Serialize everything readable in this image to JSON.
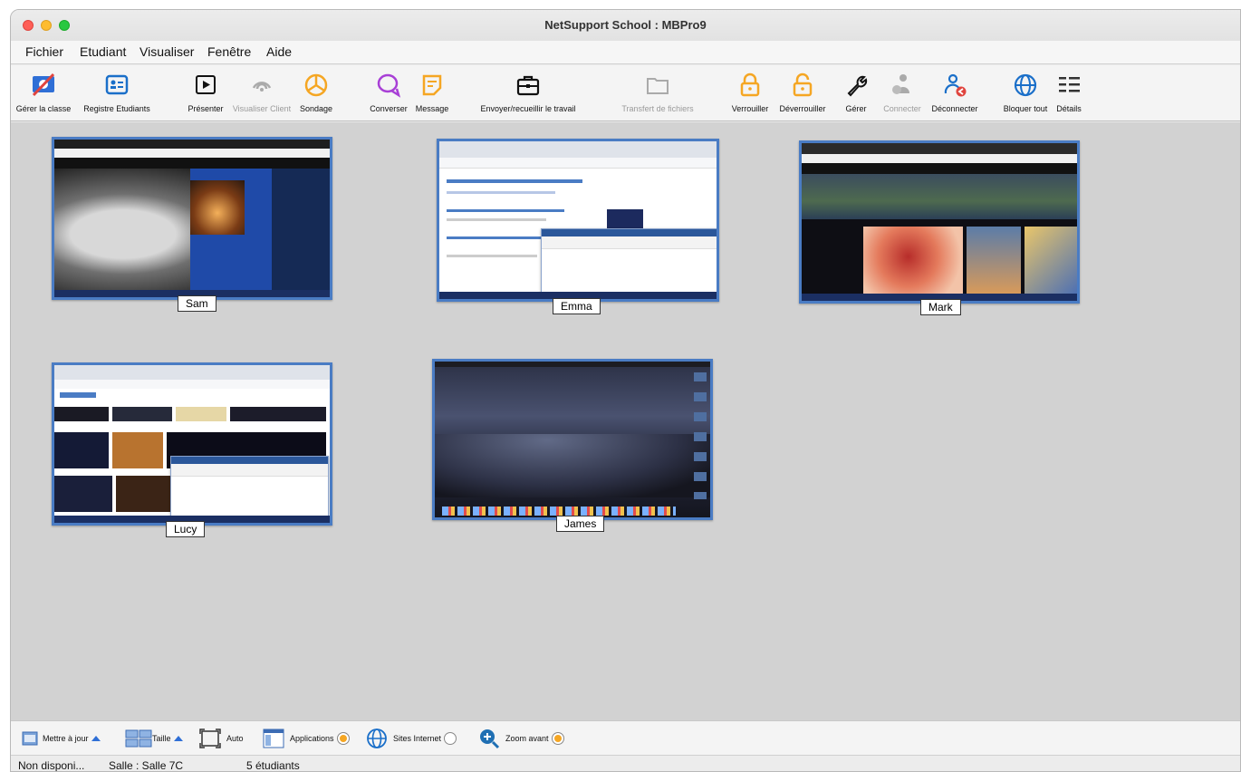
{
  "window": {
    "title": "NetSupport School : MBPro9"
  },
  "menu": [
    "Fichier",
    "Etudiant",
    "Visualiser",
    "Fenêtre",
    "Aide"
  ],
  "toolbar": [
    {
      "label": "Gérer la classe",
      "icon": "manage-class-icon",
      "enabled": true
    },
    {
      "label": "Registre Etudiants",
      "icon": "student-register-icon",
      "enabled": true
    },
    {
      "label": "Présenter",
      "icon": "present-icon",
      "enabled": true
    },
    {
      "label": "Visualiser Client",
      "icon": "view-client-icon",
      "enabled": false
    },
    {
      "label": "Sondage",
      "icon": "survey-icon",
      "enabled": true
    },
    {
      "label": "Converser",
      "icon": "chat-icon",
      "enabled": true
    },
    {
      "label": "Message",
      "icon": "message-icon",
      "enabled": true
    },
    {
      "label": "Envoyer/recueillir le travail",
      "icon": "send-collect-work-icon",
      "enabled": true
    },
    {
      "label": "Transfert de fichiers",
      "icon": "file-transfer-icon",
      "enabled": false
    },
    {
      "label": "Verrouiller",
      "icon": "lock-icon",
      "enabled": true
    },
    {
      "label": "Déverrouiller",
      "icon": "unlock-icon",
      "enabled": true
    },
    {
      "label": "Gérer",
      "icon": "wrench-icon",
      "enabled": true
    },
    {
      "label": "Connecter",
      "icon": "connect-icon",
      "enabled": false
    },
    {
      "label": "Déconnecter",
      "icon": "disconnect-icon",
      "enabled": true
    },
    {
      "label": "Bloquer tout",
      "icon": "globe-icon",
      "enabled": true
    },
    {
      "label": "Détails",
      "icon": "details-list-icon",
      "enabled": true
    }
  ],
  "students": [
    {
      "name": "Sam"
    },
    {
      "name": "Emma"
    },
    {
      "name": "Mark"
    },
    {
      "name": "Lucy"
    },
    {
      "name": "James"
    }
  ],
  "bottombar": {
    "update": "Mettre à jour",
    "size": "Taille",
    "auto": "Auto",
    "applications": "Applications",
    "websites": "Sites Internet",
    "zoom": "Zoom avant"
  },
  "status": {
    "availability": "Non disponi...",
    "room": "Salle : Salle 7C",
    "count": "5 étudiants"
  },
  "colors": {
    "accent": "#4a7cc4",
    "orange": "#f5a623",
    "purple": "#a83fd6",
    "blue": "#2f6fd6"
  }
}
